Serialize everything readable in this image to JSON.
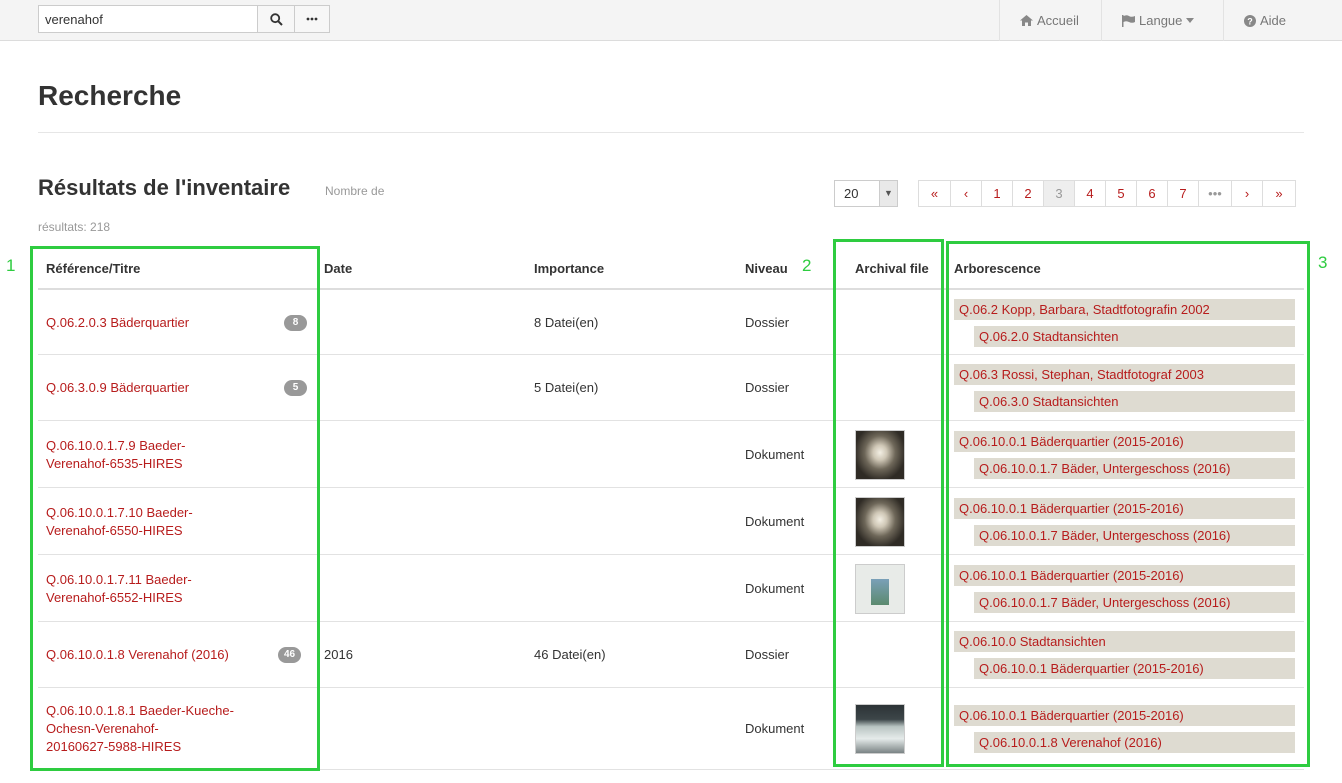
{
  "search": {
    "value": "verenahof"
  },
  "nav": {
    "home": "Accueil",
    "language": "Langue",
    "help": "Aide"
  },
  "page_title": "Recherche",
  "results": {
    "title": "Résultats de l'inventaire",
    "count_label": "Nombre de",
    "count_value": "résultats: 218",
    "per_page": "20",
    "pagination": [
      "«",
      "‹",
      "1",
      "2",
      "3",
      "4",
      "5",
      "6",
      "7",
      "•••",
      "›",
      "»"
    ],
    "active_page": "3"
  },
  "table": {
    "headers": {
      "ref": "Référence/Titre",
      "date": "Date",
      "importance": "Importance",
      "level": "Niveau",
      "archival": "Archival file",
      "tree": "Arborescence"
    },
    "rows": [
      {
        "ref": [
          "Q.06.2.0.3 Bäderquartier"
        ],
        "badge": "8",
        "date": "",
        "importance": "8 Datei(en)",
        "level": "Dossier",
        "thumb": "",
        "tree1": "Q.06.2 Kopp, Barbara, Stadtfotografin 2002",
        "tree2": "Q.06.2.0 Stadtansichten"
      },
      {
        "ref": [
          "Q.06.3.0.9 Bäderquartier"
        ],
        "badge": "5",
        "date": "",
        "importance": "5 Datei(en)",
        "level": "Dossier",
        "thumb": "",
        "tree1": "Q.06.3 Rossi, Stephan, Stadtfotograf 2003",
        "tree2": "Q.06.3.0 Stadtansichten"
      },
      {
        "ref": [
          "Q.06.10.0.1.7.9 Baeder-",
          "Verenahof-6535-HIRES"
        ],
        "badge": "",
        "date": "",
        "importance": "",
        "level": "Dokument",
        "thumb": "corridor",
        "tree1": "Q.06.10.0.1 Bäderquartier (2015-2016)",
        "tree2": "Q.06.10.0.1.7 Bäder, Untergeschoss (2016)"
      },
      {
        "ref": [
          "Q.06.10.0.1.7.10 Baeder-",
          "Verenahof-6550-HIRES"
        ],
        "badge": "",
        "date": "",
        "importance": "",
        "level": "Dokument",
        "thumb": "corridor",
        "tree1": "Q.06.10.0.1 Bäderquartier (2015-2016)",
        "tree2": "Q.06.10.0.1.7 Bäder, Untergeschoss (2016)"
      },
      {
        "ref": [
          "Q.06.10.0.1.7.11 Baeder-",
          "Verenahof-6552-HIRES"
        ],
        "badge": "",
        "date": "",
        "importance": "",
        "level": "Dokument",
        "thumb": "poster",
        "tree1": "Q.06.10.0.1 Bäderquartier (2015-2016)",
        "tree2": "Q.06.10.0.1.7 Bäder, Untergeschoss (2016)"
      },
      {
        "ref": [
          "Q.06.10.0.1.8 Verenahof (2016)"
        ],
        "badge": "46",
        "date": "2016",
        "importance": "46 Datei(en)",
        "level": "Dossier",
        "thumb": "",
        "tree1": "Q.06.10.0 Stadtansichten",
        "tree2": "Q.06.10.0.1 Bäderquartier (2015-2016)"
      },
      {
        "ref": [
          "Q.06.10.0.1.8.1 Baeder-Kueche-",
          "Ochesn-Verenahof-",
          "20160627-5988-HIRES"
        ],
        "badge": "",
        "date": "",
        "importance": "",
        "level": "Dokument",
        "thumb": "kitchen",
        "tree1": "Q.06.10.0.1 Bäderquartier (2015-2016)",
        "tree2": "Q.06.10.0.1.8 Verenahof (2016)"
      }
    ]
  },
  "annotations": [
    "1",
    "2",
    "3"
  ],
  "colors": {
    "link": "#b71c1c",
    "annotation": "#2ecc40",
    "tree_bg": "#dedbd1"
  }
}
